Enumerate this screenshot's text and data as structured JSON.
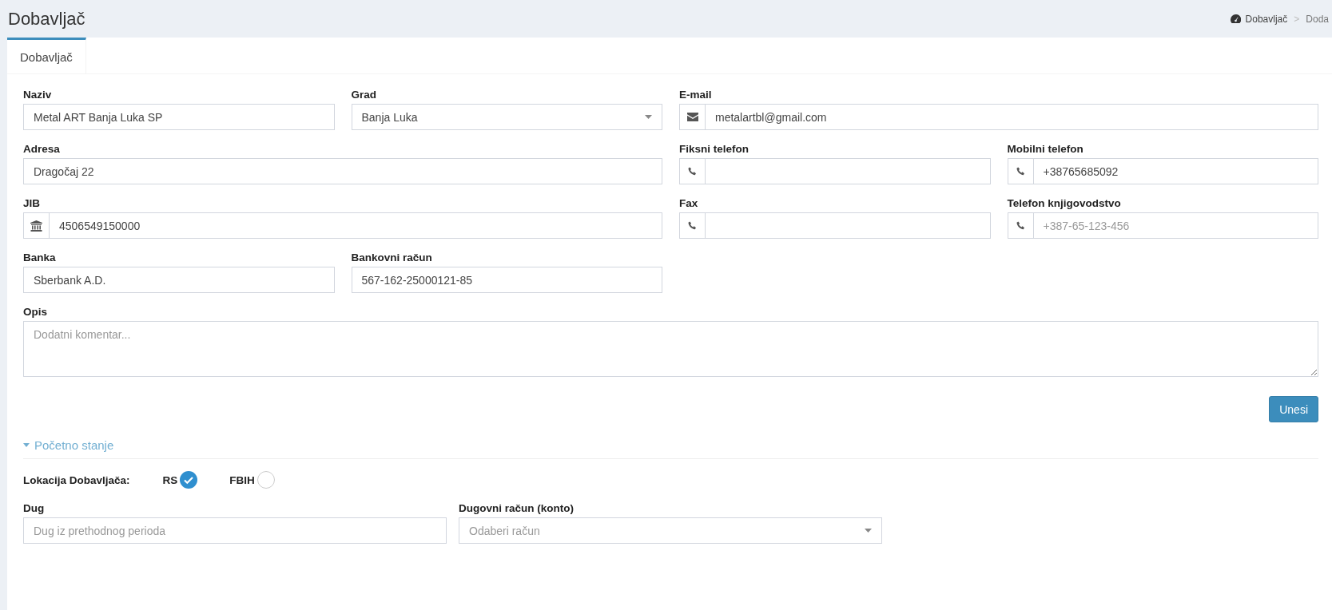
{
  "header": {
    "title": "Dobavljač",
    "breadcrumb": [
      {
        "label": "Dobavljač",
        "kind": "home"
      },
      {
        "label": "Doda",
        "kind": "plain"
      }
    ],
    "separator": ">"
  },
  "tabs": [
    {
      "label": "Dobavljač",
      "selected": true
    }
  ],
  "fields": [
    {
      "label": "Naziv",
      "kind": "text",
      "value": "Metal ART Banja Luka SP"
    },
    {
      "label": "Grad",
      "kind": "select",
      "value": "Banja Luka"
    },
    {
      "label": "E-mail",
      "kind": "email",
      "value": "metalartbl@gmail.com"
    },
    {
      "label": "Adresa",
      "kind": "text",
      "value": "Dragočaj 22"
    },
    {
      "label": "Fiksni telefon",
      "kind": "phone"
    },
    {
      "label": "Mobilni telefon",
      "kind": "phone",
      "value": "+38765685092"
    },
    {
      "label": "JIB",
      "kind": "bank",
      "value": "4506549150000"
    },
    {
      "label": "Fax",
      "kind": "phone"
    },
    {
      "label": "Telefon knjigovodstvo",
      "kind": "phone",
      "placeholder": "+387-65-123-456"
    },
    {
      "label": "Banka",
      "kind": "text",
      "value": "Sberbank A.D."
    },
    {
      "label": "Bankovni račun",
      "kind": "text",
      "value": "567-162-25000121-85"
    },
    {
      "label": "Opis",
      "kind": "textarea",
      "placeholder": "Dodatni komentar..."
    }
  ],
  "submit_button": "Unesi",
  "opening_balance": {
    "title": "Početno stanje",
    "expanded": true,
    "location": {
      "label": "Lokacija Dobavljača:",
      "options": [
        {
          "label": "RS",
          "selected": true
        },
        {
          "label": "FBIH",
          "selected": false
        }
      ]
    },
    "fields": [
      {
        "label": "Dug",
        "kind": "text",
        "placeholder": "Dug iz prethodnog perioda"
      },
      {
        "label": "Dugovni račun (konto)",
        "kind": "select",
        "placeholder": "Odaberi račun"
      }
    ]
  }
}
